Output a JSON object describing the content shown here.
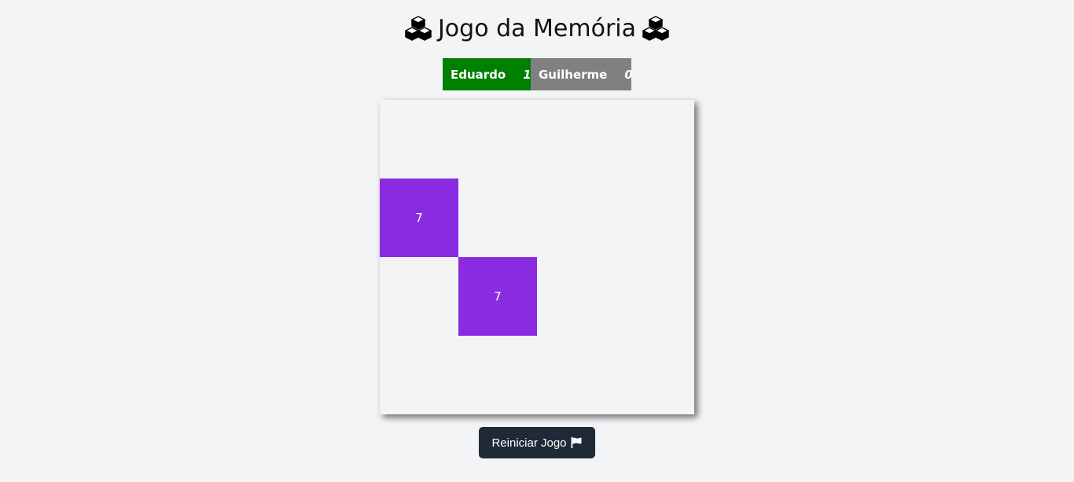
{
  "header": {
    "title": "Jogo da Memória",
    "left_icon": "cubes-icon",
    "right_icon": "cubes-icon"
  },
  "scoreboard": {
    "players": [
      {
        "name": "Eduardo",
        "score": "1",
        "color": "#008000",
        "active": true
      },
      {
        "name": "Guilherme",
        "score": "0",
        "color": "#808080",
        "active": false
      }
    ]
  },
  "board": {
    "rows": 4,
    "cols": 4,
    "revealed_color": "#8a2be2",
    "cells": [
      "",
      "",
      "",
      "",
      "7",
      "",
      "",
      "",
      "",
      "7",
      "",
      "",
      "",
      "",
      "",
      ""
    ]
  },
  "controls": {
    "restart_label": "Reiniciar Jogo",
    "restart_icon": "flag-icon"
  }
}
